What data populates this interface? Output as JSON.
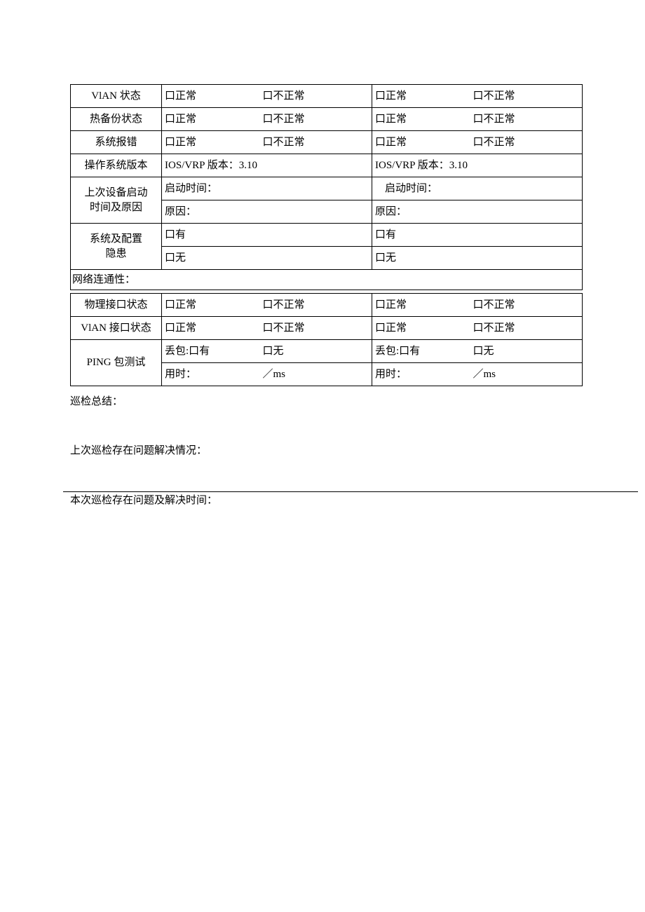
{
  "labels": {
    "vlan_state": "VlAN 状态",
    "hot_backup": "热备份状态",
    "sys_error": "系统报错",
    "os_version": "操作系统版本",
    "last_boot": "上次设备启动",
    "last_boot_2": "时间及原因",
    "sys_conf_risk": "系统及配置",
    "sys_conf_risk_2": "隐患",
    "net_conn": "网络连通性：",
    "phy_if_state": "物理接口状态",
    "vlan_if_state": "VlAN 接口状态",
    "ping_test": "PING 包测试",
    "summary": "巡检总结：",
    "last_issues": "上次巡检存在问题解决情况：",
    "this_issues": "本次巡检存在问题及解决时间："
  },
  "fields": {
    "normal": "口正常",
    "abnormal": "口不正常",
    "os_a": "IOS/VRP 版本：3.10",
    "os_b": "IOS/VRP 版本：3.10",
    "boot_time": "启动时间：",
    "reason": "原因：",
    "have": "口有",
    "none": "口无",
    "drop_label": "丢包:口有",
    "drop_none": "口无",
    "time_label": "用时：",
    "ms_unit": "／ms"
  }
}
